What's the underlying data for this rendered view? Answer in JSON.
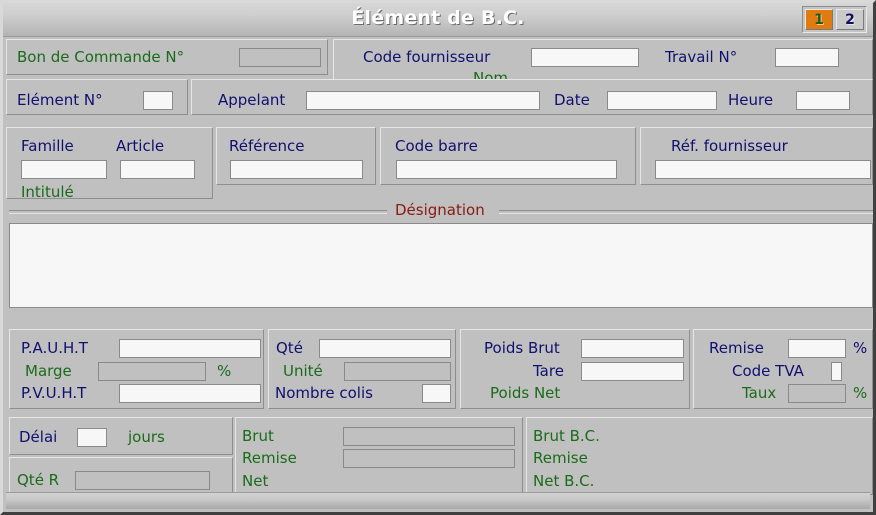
{
  "window": {
    "title": "Élément de B.C.",
    "tabs": [
      {
        "label": "1",
        "active": true
      },
      {
        "label": "2",
        "active": false
      }
    ]
  },
  "header": {
    "bon_de_commande_label": "Bon de Commande N°",
    "bon_de_commande_value": "",
    "code_fournisseur_label": "Code fournisseur",
    "code_fournisseur_value": "",
    "nom_label": "Nom",
    "nom_value": "",
    "travail_label": "Travail N°",
    "travail_value": "",
    "element_label": "Elément N°",
    "element_value": "",
    "appelant_label": "Appelant",
    "appelant_value": "",
    "date_label": "Date",
    "date_value": "",
    "heure_label": "Heure",
    "heure_value": ""
  },
  "article": {
    "famille_label": "Famille",
    "famille_value": "",
    "article_label": "Article",
    "article_value": "",
    "reference_label": "Référence",
    "reference_value": "",
    "code_barre_label": "Code barre",
    "code_barre_value": "",
    "ref_fournisseur_label": "Réf. fournisseur",
    "ref_fournisseur_value": "",
    "intitule_label": "Intitulé",
    "intitule_value": ""
  },
  "designation": {
    "legend": "Désignation",
    "value": ""
  },
  "prices": {
    "pauht_label": "P.A.U.H.T",
    "pauht_value": "",
    "marge_label": "Marge",
    "marge_value": "",
    "marge_unit": "%",
    "pvuht_label": "P.V.U.H.T",
    "pvuht_value": ""
  },
  "quantity": {
    "qte_label": "Qté",
    "qte_value": "",
    "unite_label": "Unité",
    "unite_value": "",
    "nombre_colis_label": "Nombre colis",
    "nombre_colis_value": ""
  },
  "weights": {
    "poids_brut_label": "Poids Brut",
    "poids_brut_value": "",
    "tare_label": "Tare",
    "tare_value": "",
    "poids_net_label": "Poids Net",
    "poids_net_value": ""
  },
  "taxes": {
    "remise_label": "Remise",
    "remise_value": "",
    "remise_unit": "%",
    "code_tva_label": "Code TVA",
    "code_tva_value": "",
    "taux_label": "Taux",
    "taux_value": "",
    "taux_unit": "%"
  },
  "delay": {
    "delai_label": "Délai",
    "delai_value": "",
    "jours_label": "jours",
    "qte_r_label": "Qté R",
    "qte_r_value": ""
  },
  "totals_line": {
    "brut_label": "Brut",
    "brut_value": "",
    "remise_label": "Remise",
    "remise_value": "",
    "net_label": "Net",
    "net_value": ""
  },
  "totals_bc": {
    "brut_bc_label": "Brut B.C.",
    "brut_bc_value": "",
    "remise_label": "Remise",
    "remise_value": "",
    "net_bc_label": "Net B.C.",
    "net_bc_value": ""
  },
  "colors": {
    "label_blue": "#101070",
    "label_green": "#1a6b1a",
    "legend_maroon": "#8b1a10",
    "tab_active": "#e07b10",
    "face": "#c0c0c0"
  }
}
